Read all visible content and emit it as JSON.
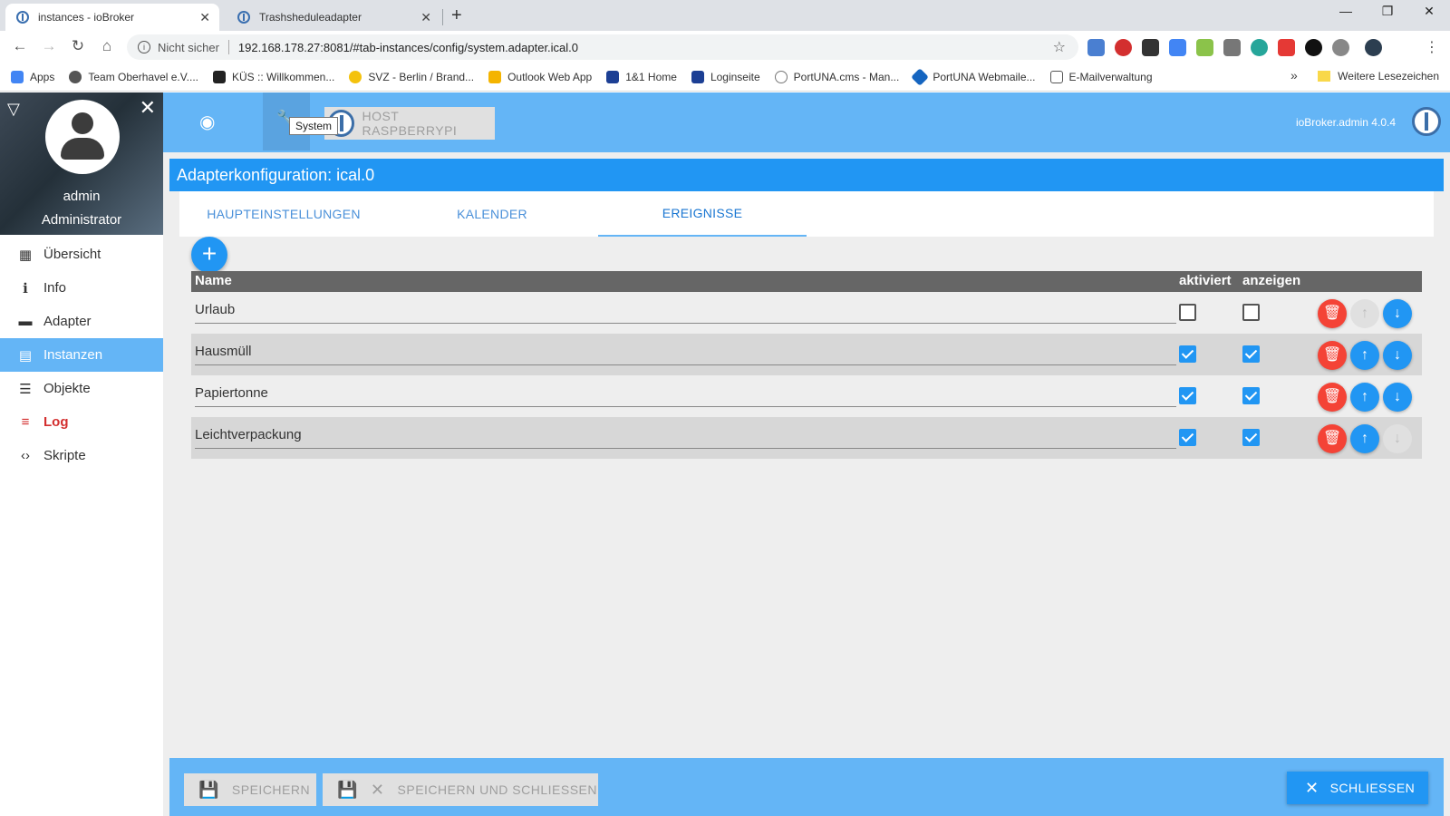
{
  "browser": {
    "tabs": [
      {
        "title": "instances - ioBroker",
        "active": true
      },
      {
        "title": "Trashsheduleadapter",
        "active": false
      }
    ],
    "address": {
      "security": "Nicht sicher",
      "url": "192.168.178.27:8081/#tab-instances/config/system.adapter.ical.0"
    },
    "bookmarks": [
      {
        "label": "Apps",
        "color": "#4285f4"
      },
      {
        "label": "Team Oberhavel e.V....",
        "color": "#555555"
      },
      {
        "label": "KÜS :: Willkommen...",
        "color": "#222222"
      },
      {
        "label": "SVZ - Berlin / Brand...",
        "color": "#f4c20d"
      },
      {
        "label": "Outlook Web App",
        "color": "#f4b400"
      },
      {
        "label": "1&1 Home",
        "color": "#1c3f94"
      },
      {
        "label": "Loginseite",
        "color": "#1c3f94"
      },
      {
        "label": "PortUNA.cms - Man...",
        "color": "#777777"
      },
      {
        "label": "PortUNA Webmaile...",
        "color": "#1565c0"
      },
      {
        "label": "E-Mailverwaltung",
        "color": "#555555"
      }
    ],
    "bookmarks_more": "»",
    "other_bookmarks": "Weitere Lesezeichen"
  },
  "sidebar": {
    "user_name": "admin",
    "user_role": "Administrator",
    "items": [
      {
        "label": "Übersicht",
        "icon": "grid-icon",
        "glyph": "▦"
      },
      {
        "label": "Info",
        "icon": "info-icon",
        "glyph": "ℹ"
      },
      {
        "label": "Adapter",
        "icon": "store-icon",
        "glyph": "▬"
      },
      {
        "label": "Instanzen",
        "icon": "instances-icon",
        "glyph": "▤"
      },
      {
        "label": "Objekte",
        "icon": "list-icon",
        "glyph": "☰"
      },
      {
        "label": "Log",
        "icon": "log-icon",
        "glyph": "≡"
      },
      {
        "label": "Skripte",
        "icon": "code-icon",
        "glyph": "‹›"
      }
    ],
    "active_item": "Instanzen"
  },
  "topbar": {
    "tooltip": "System",
    "host_button": "HOST RASPBERRYPI",
    "version": "ioBroker.admin 4.0.4"
  },
  "config": {
    "title": "Adapterkonfiguration: ical.0",
    "tabs": [
      "HAUPTEINSTELLUNGEN",
      "KALENDER",
      "EREIGNISSE"
    ],
    "active_tab": "EREIGNISSE",
    "add_label": "+"
  },
  "events": {
    "headers": {
      "name": "Name",
      "aktiviert": "aktiviert",
      "anzeigen": "anzeigen"
    },
    "rows": [
      {
        "name": "Urlaub",
        "aktiviert": false,
        "anzeigen": false,
        "up_enabled": false,
        "down_enabled": true
      },
      {
        "name": "Hausmüll",
        "aktiviert": true,
        "anzeigen": true,
        "up_enabled": true,
        "down_enabled": true
      },
      {
        "name": "Papiertonne",
        "aktiviert": true,
        "anzeigen": true,
        "up_enabled": true,
        "down_enabled": true
      },
      {
        "name": "Leichtverpackung",
        "aktiviert": true,
        "anzeigen": true,
        "up_enabled": true,
        "down_enabled": false
      }
    ]
  },
  "footer": {
    "save": "SPEICHERN",
    "save_close": "SPEICHERN UND SCHLIESSEN",
    "close": "SCHLIESSEN"
  },
  "colors": {
    "primary": "#2196f3",
    "topbar": "#64b5f6",
    "danger": "#f44336",
    "log": "#d32f2f"
  }
}
